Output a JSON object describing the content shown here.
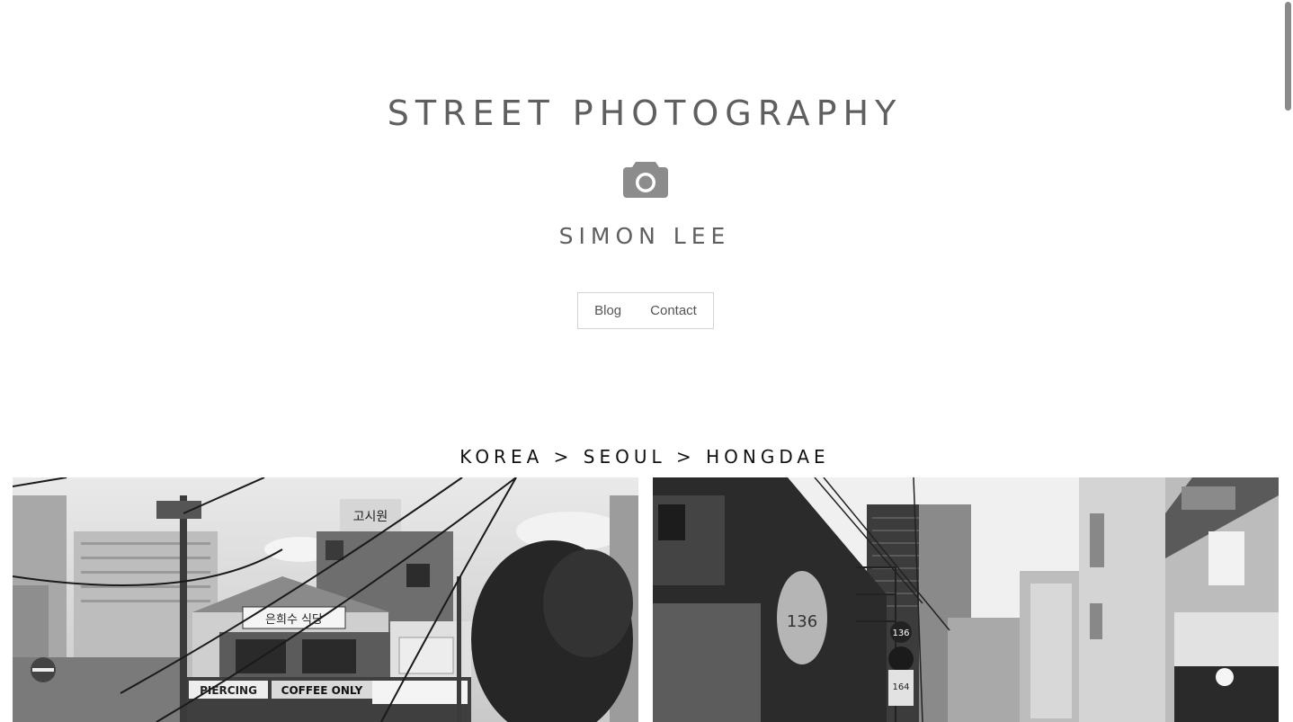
{
  "header": {
    "title": "STREET PHOTOGRAPHY",
    "author": "SIMON LEE",
    "logo_icon": "camera-icon"
  },
  "nav": {
    "items": [
      {
        "label": "Blog"
      },
      {
        "label": "Contact"
      }
    ]
  },
  "gallery": {
    "breadcrumb": "KOREA > SEOUL > HONGDAE",
    "photos": [
      {
        "signs": [
          "은희수 식당",
          "PIERCING",
          "COFFEE ONLY",
          "고시원"
        ]
      },
      {
        "signs": [
          "136",
          "136",
          "164"
        ]
      }
    ]
  },
  "colors": {
    "text_gray": "#5f5f5f",
    "text_dark": "#111111",
    "nav_border": "#d3d3d3"
  }
}
